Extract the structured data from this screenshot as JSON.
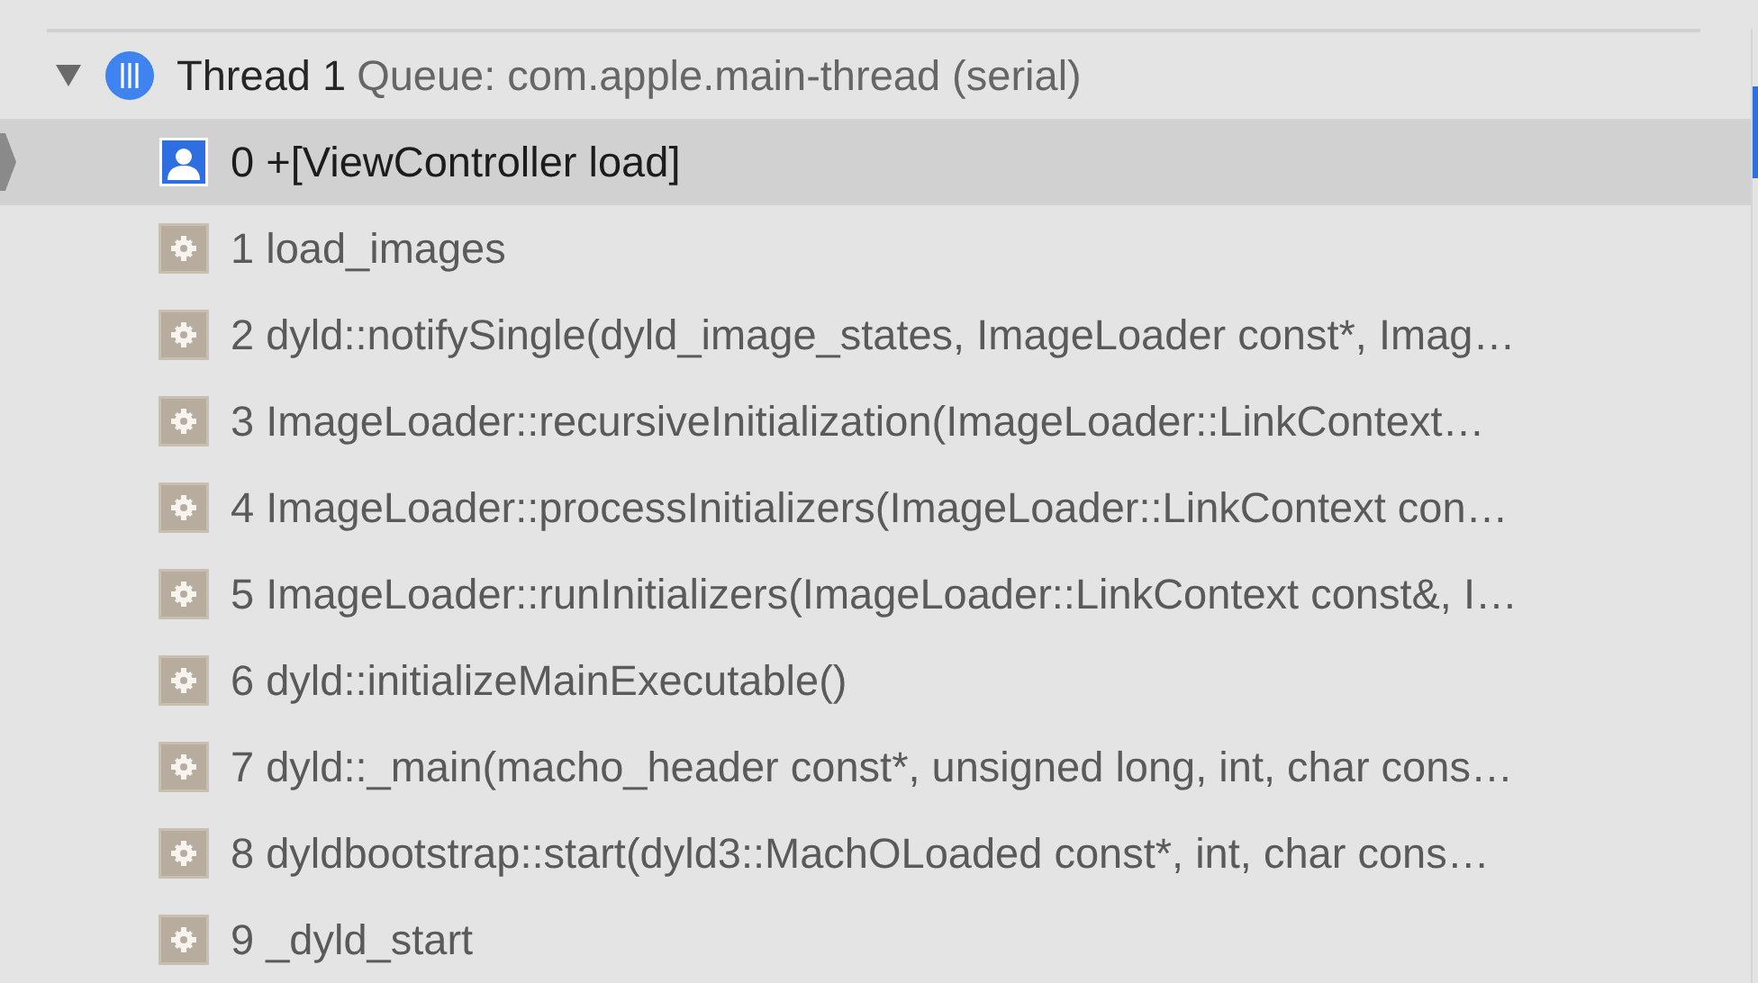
{
  "thread": {
    "name": "Thread 1",
    "queue": "Queue: com.apple.main-thread (serial)",
    "expanded": true
  },
  "frames": [
    {
      "text": "0 +[ViewController load]",
      "kind": "user",
      "selected": true
    },
    {
      "text": "1 load_images",
      "kind": "system",
      "selected": false
    },
    {
      "text": "2 dyld::notifySingle(dyld_image_states, ImageLoader const*, Imag…",
      "kind": "system",
      "selected": false
    },
    {
      "text": "3 ImageLoader::recursiveInitialization(ImageLoader::LinkContext…",
      "kind": "system",
      "selected": false
    },
    {
      "text": "4 ImageLoader::processInitializers(ImageLoader::LinkContext con…",
      "kind": "system",
      "selected": false
    },
    {
      "text": "5 ImageLoader::runInitializers(ImageLoader::LinkContext const&, I…",
      "kind": "system",
      "selected": false
    },
    {
      "text": "6 dyld::initializeMainExecutable()",
      "kind": "system",
      "selected": false
    },
    {
      "text": "7 dyld::_main(macho_header const*, unsigned long, int, char cons…",
      "kind": "system",
      "selected": false
    },
    {
      "text": "8 dyldbootstrap::start(dyld3::MachOLoaded const*, int, char cons…",
      "kind": "system",
      "selected": false
    },
    {
      "text": "9 _dyld_start",
      "kind": "system",
      "selected": false
    }
  ]
}
